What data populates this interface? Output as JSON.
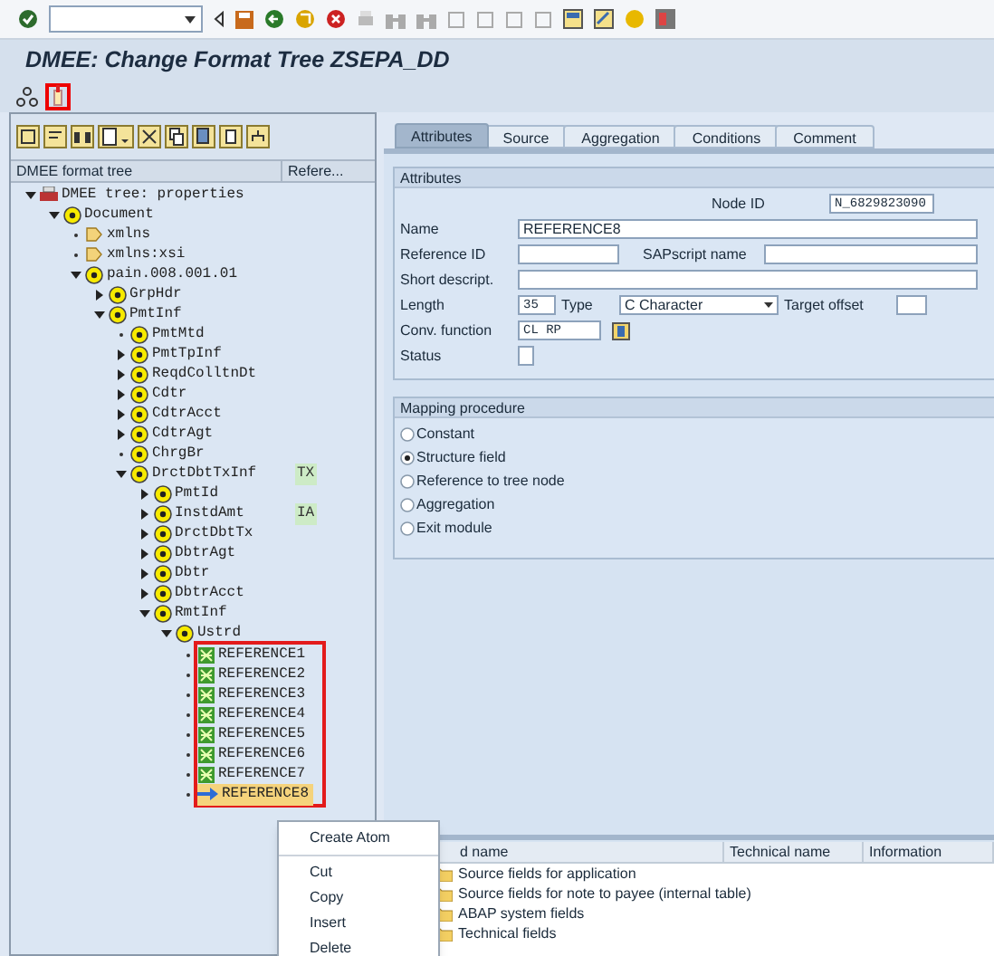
{
  "window": {
    "title": "DMEE: Change Format Tree ZSEPA_DD"
  },
  "application_toolbar": [
    {
      "kind": "hierarchy",
      "boxed": false
    },
    {
      "kind": "marker",
      "boxed": true
    }
  ],
  "tree": {
    "columns": [
      "DMEE format tree",
      "Refere..."
    ],
    "nodes": [
      {
        "label": "DMEE tree: properties",
        "kind": "root",
        "expandable": true,
        "expanded": true,
        "selected": false,
        "children": [
          {
            "label": "Document",
            "kind": "node",
            "expandable": true,
            "expanded": true,
            "selected": false,
            "children": [
              {
                "label": "xmlns",
                "kind": "attribute",
                "expandable": false,
                "selected": false
              },
              {
                "label": "xmlns:xsi",
                "kind": "attribute",
                "expandable": false,
                "selected": false
              },
              {
                "label": "pain.008.001.01",
                "kind": "node",
                "expandable": true,
                "expanded": true,
                "selected": false,
                "children": [
                  {
                    "label": "GrpHdr",
                    "kind": "node",
                    "expandable": true,
                    "expanded": false,
                    "selected": false
                  },
                  {
                    "label": "PmtInf",
                    "kind": "node",
                    "expandable": true,
                    "expanded": true,
                    "selected": false,
                    "children": [
                      {
                        "label": "PmtMtd",
                        "kind": "node",
                        "expandable": false,
                        "selected": false
                      },
                      {
                        "label": "PmtTpInf",
                        "kind": "node",
                        "expandable": true,
                        "expanded": false,
                        "selected": false
                      },
                      {
                        "label": "ReqdColltnDt",
                        "kind": "node",
                        "expandable": true,
                        "expanded": false,
                        "selected": false
                      },
                      {
                        "label": "Cdtr",
                        "kind": "node",
                        "expandable": true,
                        "expanded": false,
                        "selected": false
                      },
                      {
                        "label": "CdtrAcct",
                        "kind": "node",
                        "expandable": true,
                        "expanded": false,
                        "selected": false
                      },
                      {
                        "label": "CdtrAgt",
                        "kind": "node",
                        "expandable": true,
                        "expanded": false,
                        "selected": false
                      },
                      {
                        "label": "ChrgBr",
                        "kind": "node",
                        "expandable": false,
                        "selected": false
                      },
                      {
                        "label": "DrctDbtTxInf",
                        "kind": "node",
                        "expandable": true,
                        "expanded": true,
                        "selected": false,
                        "reference": "TX",
                        "children": [
                          {
                            "label": "PmtId",
                            "kind": "node",
                            "expandable": true,
                            "expanded": false,
                            "selected": false
                          },
                          {
                            "label": "InstdAmt",
                            "kind": "node",
                            "expandable": true,
                            "expanded": false,
                            "selected": false,
                            "reference": "IA"
                          },
                          {
                            "label": "DrctDbtTx",
                            "kind": "node",
                            "expandable": true,
                            "expanded": false,
                            "selected": false
                          },
                          {
                            "label": "DbtrAgt",
                            "kind": "node",
                            "expandable": true,
                            "expanded": false,
                            "selected": false
                          },
                          {
                            "label": "Dbtr",
                            "kind": "node",
                            "expandable": true,
                            "expanded": false,
                            "selected": false
                          },
                          {
                            "label": "DbtrAcct",
                            "kind": "node",
                            "expandable": true,
                            "expanded": false,
                            "selected": false
                          },
                          {
                            "label": "RmtInf",
                            "kind": "node",
                            "expandable": true,
                            "expanded": true,
                            "selected": false,
                            "children": [
                              {
                                "label": "Ustrd",
                                "kind": "node",
                                "expandable": true,
                                "expanded": true,
                                "selected": false,
                                "boxed_children": true,
                                "children": [
                                  {
                                    "label": "REFERENCE1",
                                    "kind": "atom",
                                    "expandable": false,
                                    "selected": false
                                  },
                                  {
                                    "label": "REFERENCE2",
                                    "kind": "atom",
                                    "expandable": false,
                                    "selected": false
                                  },
                                  {
                                    "label": "REFERENCE3",
                                    "kind": "atom",
                                    "expandable": false,
                                    "selected": false
                                  },
                                  {
                                    "label": "REFERENCE4",
                                    "kind": "atom",
                                    "expandable": false,
                                    "selected": false
                                  },
                                  {
                                    "label": "REFERENCE5",
                                    "kind": "atom",
                                    "expandable": false,
                                    "selected": false
                                  },
                                  {
                                    "label": "REFERENCE6",
                                    "kind": "atom",
                                    "expandable": false,
                                    "selected": false
                                  },
                                  {
                                    "label": "REFERENCE7",
                                    "kind": "atom",
                                    "expandable": false,
                                    "selected": false
                                  },
                                  {
                                    "label": "REFERENCE8",
                                    "kind": "arrow",
                                    "expandable": false,
                                    "selected": true
                                  }
                                ]
                              }
                            ]
                          }
                        ]
                      }
                    ]
                  }
                ]
              }
            ]
          }
        ]
      }
    ]
  },
  "context_menu": [
    {
      "label": "Create Atom",
      "separator_after": true
    },
    {
      "label": "Cut",
      "separator_after": false
    },
    {
      "label": "Copy",
      "separator_after": false
    },
    {
      "label": "Insert",
      "separator_after": false
    },
    {
      "label": "Delete",
      "separator_after": false
    }
  ],
  "tabs": [
    {
      "label": "Attributes",
      "selected": true
    },
    {
      "label": "Source",
      "selected": false
    },
    {
      "label": "Aggregation",
      "selected": false
    },
    {
      "label": "Conditions",
      "selected": false
    },
    {
      "label": "Comment",
      "selected": false
    }
  ],
  "attributes": {
    "title": "Attributes",
    "node_id": {
      "label": "Node ID",
      "value": "N_6829823090"
    },
    "name": {
      "label": "Name",
      "value": "REFERENCE8"
    },
    "reference_id": {
      "label": "Reference ID"
    },
    "sapscript_name": {
      "label": "SAPscript name"
    },
    "short_description": {
      "label": "Short descript."
    },
    "length": {
      "label": "Length",
      "value": "35"
    },
    "type": {
      "label": "Type",
      "value": "C Character"
    },
    "target_offset": {
      "label": "Target offset"
    },
    "conversion_function": {
      "label": "Conv. function",
      "value": "CL RP"
    },
    "status": {
      "label": "Status"
    }
  },
  "mapping_procedure": {
    "title": "Mapping procedure",
    "options": [
      {
        "label": "Constant",
        "selected": false
      },
      {
        "label": "Structure field",
        "selected": true
      },
      {
        "label": "Reference to tree node",
        "selected": false
      },
      {
        "label": "Aggregation",
        "selected": false
      },
      {
        "label": "Exit module",
        "selected": false
      }
    ]
  },
  "source_fields": {
    "columns": [
      "d name",
      "Technical name",
      "Information"
    ],
    "rows": [
      {
        "label": "Source fields for application"
      },
      {
        "label": "Source fields for note to payee (internal table)"
      },
      {
        "label": "ABAP system fields"
      },
      {
        "label": "Technical fields"
      }
    ]
  }
}
